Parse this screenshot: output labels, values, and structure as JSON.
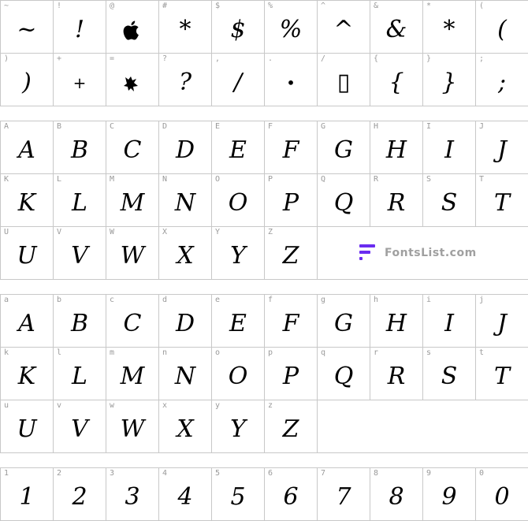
{
  "sections": [
    {
      "id": "symbols",
      "cells": [
        {
          "key": "~",
          "glyph": "~"
        },
        {
          "key": "!",
          "glyph": "!"
        },
        {
          "key": "@",
          "glyph": "",
          "icon": "apple-logo-icon"
        },
        {
          "key": "#",
          "glyph": "*"
        },
        {
          "key": "$",
          "glyph": "$"
        },
        {
          "key": "%",
          "glyph": "%"
        },
        {
          "key": "^",
          "glyph": "^"
        },
        {
          "key": "&",
          "glyph": "&"
        },
        {
          "key": "*",
          "glyph": "*"
        },
        {
          "key": "(",
          "glyph": "("
        },
        {
          "key": ")",
          "glyph": ")"
        },
        {
          "key": "+",
          "glyph": "+"
        },
        {
          "key": "=",
          "glyph": "",
          "icon": "ink-blot-icon"
        },
        {
          "key": "?",
          "glyph": "?"
        },
        {
          "key": ",",
          "glyph": "/"
        },
        {
          "key": ".",
          "glyph": "•"
        },
        {
          "key": "/",
          "glyph": "▯"
        },
        {
          "key": "{",
          "glyph": "{"
        },
        {
          "key": "}",
          "glyph": "}"
        },
        {
          "key": ";",
          "glyph": ";"
        }
      ]
    },
    {
      "id": "uppercase",
      "cells": [
        {
          "key": "A",
          "glyph": "A"
        },
        {
          "key": "B",
          "glyph": "B"
        },
        {
          "key": "C",
          "glyph": "C"
        },
        {
          "key": "D",
          "glyph": "D"
        },
        {
          "key": "E",
          "glyph": "E"
        },
        {
          "key": "F",
          "glyph": "F"
        },
        {
          "key": "G",
          "glyph": "G"
        },
        {
          "key": "H",
          "glyph": "H"
        },
        {
          "key": "I",
          "glyph": "I"
        },
        {
          "key": "J",
          "glyph": "J"
        },
        {
          "key": "K",
          "glyph": "K"
        },
        {
          "key": "L",
          "glyph": "L"
        },
        {
          "key": "M",
          "glyph": "M"
        },
        {
          "key": "N",
          "glyph": "N"
        },
        {
          "key": "O",
          "glyph": "O"
        },
        {
          "key": "P",
          "glyph": "P"
        },
        {
          "key": "Q",
          "glyph": "Q"
        },
        {
          "key": "R",
          "glyph": "R"
        },
        {
          "key": "S",
          "glyph": "S"
        },
        {
          "key": "T",
          "glyph": "T"
        },
        {
          "key": "U",
          "glyph": "U"
        },
        {
          "key": "V",
          "glyph": "V"
        },
        {
          "key": "W",
          "glyph": "W"
        },
        {
          "key": "X",
          "glyph": "X"
        },
        {
          "key": "Y",
          "glyph": "Y"
        },
        {
          "key": "Z",
          "glyph": "Z"
        }
      ]
    },
    {
      "id": "lowercase",
      "cells": [
        {
          "key": "a",
          "glyph": "A"
        },
        {
          "key": "b",
          "glyph": "B"
        },
        {
          "key": "c",
          "glyph": "C"
        },
        {
          "key": "d",
          "glyph": "D"
        },
        {
          "key": "e",
          "glyph": "E"
        },
        {
          "key": "f",
          "glyph": "F"
        },
        {
          "key": "g",
          "glyph": "G"
        },
        {
          "key": "h",
          "glyph": "H"
        },
        {
          "key": "i",
          "glyph": "I"
        },
        {
          "key": "j",
          "glyph": "J"
        },
        {
          "key": "k",
          "glyph": "K"
        },
        {
          "key": "l",
          "glyph": "L"
        },
        {
          "key": "m",
          "glyph": "M"
        },
        {
          "key": "n",
          "glyph": "N"
        },
        {
          "key": "o",
          "glyph": "O"
        },
        {
          "key": "p",
          "glyph": "P"
        },
        {
          "key": "q",
          "glyph": "Q"
        },
        {
          "key": "r",
          "glyph": "R"
        },
        {
          "key": "s",
          "glyph": "S"
        },
        {
          "key": "t",
          "glyph": "T"
        },
        {
          "key": "u",
          "glyph": "U"
        },
        {
          "key": "v",
          "glyph": "V"
        },
        {
          "key": "w",
          "glyph": "W"
        },
        {
          "key": "x",
          "glyph": "X"
        },
        {
          "key": "y",
          "glyph": "Y"
        },
        {
          "key": "z",
          "glyph": "Z"
        }
      ]
    },
    {
      "id": "digits",
      "cells": [
        {
          "key": "1",
          "glyph": "1"
        },
        {
          "key": "2",
          "glyph": "2"
        },
        {
          "key": "3",
          "glyph": "3"
        },
        {
          "key": "4",
          "glyph": "4"
        },
        {
          "key": "5",
          "glyph": "5"
        },
        {
          "key": "6",
          "glyph": "6"
        },
        {
          "key": "7",
          "glyph": "7"
        },
        {
          "key": "8",
          "glyph": "8"
        },
        {
          "key": "9",
          "glyph": "9"
        },
        {
          "key": "0",
          "glyph": "0"
        }
      ]
    }
  ],
  "watermark": {
    "text": "FontsList.com",
    "accent": "#6a2cf0",
    "text_color": "#a0a0a0"
  }
}
